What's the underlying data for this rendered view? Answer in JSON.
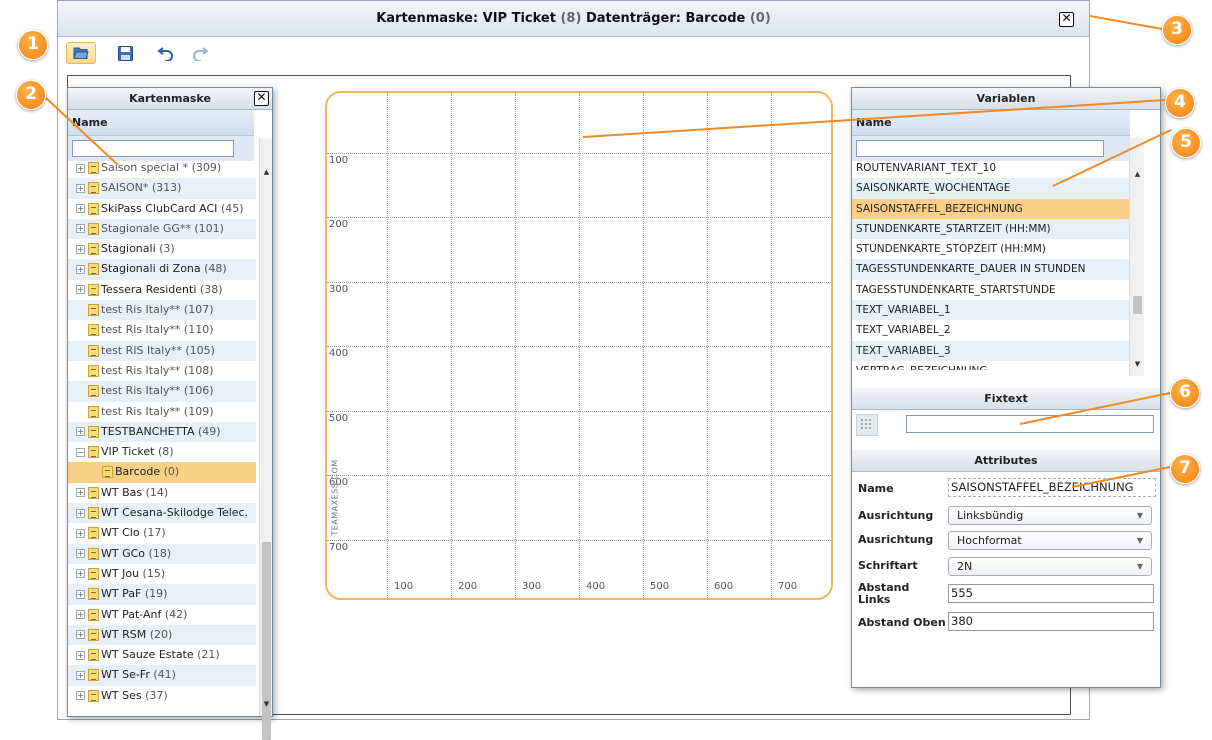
{
  "window": {
    "title_prefix": "Kartenmaske: VIP Ticket",
    "title_count1": "(8)",
    "title_mid": "Datenträger: Barcode",
    "title_count2": "(0)",
    "close_label": "✕"
  },
  "toolbar": {
    "open_icon": "folder-open-icon",
    "save_icon": "save-icon",
    "undo_icon": "undo-icon",
    "redo_icon": "redo-icon"
  },
  "kartenmaske": {
    "title": "Kartenmaske",
    "column": "Name",
    "filter_value": "",
    "rows": [
      {
        "label": "Saison special *",
        "count": "(309)",
        "expand": "+",
        "gray": true
      },
      {
        "label": "SAISON*",
        "count": "(313)",
        "expand": "+",
        "gray": true
      },
      {
        "label": "SkiPass ClubCard ACI",
        "count": "(45)",
        "expand": "+",
        "gray": false
      },
      {
        "label": "Stagionale GG**",
        "count": "(101)",
        "expand": "+",
        "gray": true
      },
      {
        "label": "Stagionali",
        "count": "(3)",
        "expand": "+",
        "gray": false
      },
      {
        "label": "Stagionali di Zona",
        "count": "(48)",
        "expand": "+",
        "gray": false
      },
      {
        "label": "Tessera Residenti",
        "count": "(38)",
        "expand": "+",
        "gray": false
      },
      {
        "label": "test Ris Italy**",
        "count": "(107)",
        "expand": "",
        "gray": true
      },
      {
        "label": "test Ris Italy**",
        "count": "(110)",
        "expand": "",
        "gray": true
      },
      {
        "label": "test RIS Italy**",
        "count": "(105)",
        "expand": "",
        "gray": true
      },
      {
        "label": "test Ris Italy**",
        "count": "(108)",
        "expand": "",
        "gray": true
      },
      {
        "label": "test Ris Italy**",
        "count": "(106)",
        "expand": "",
        "gray": true
      },
      {
        "label": "test Ris Italy**",
        "count": "(109)",
        "expand": "",
        "gray": true
      },
      {
        "label": "TESTBANCHETTA",
        "count": "(49)",
        "expand": "+",
        "gray": false
      },
      {
        "label": "VIP Ticket",
        "count": "(8)",
        "expand": "−",
        "gray": false
      },
      {
        "label": "Barcode",
        "count": "(0)",
        "expand": "",
        "gray": false,
        "child": true,
        "selected": true
      },
      {
        "label": "WT Bas",
        "count": "(14)",
        "expand": "+",
        "gray": false
      },
      {
        "label": "WT Cesana-Skilodge Telec.",
        "count": "",
        "expand": "+",
        "gray": false
      },
      {
        "label": "WT Clo",
        "count": "(17)",
        "expand": "+",
        "gray": false
      },
      {
        "label": "WT GCo",
        "count": "(18)",
        "expand": "+",
        "gray": false
      },
      {
        "label": "WT Jou",
        "count": "(15)",
        "expand": "+",
        "gray": false
      },
      {
        "label": "WT PaF",
        "count": "(19)",
        "expand": "+",
        "gray": false
      },
      {
        "label": "WT Pat-Anf",
        "count": "(42)",
        "expand": "+",
        "gray": false
      },
      {
        "label": "WT RSM",
        "count": "(20)",
        "expand": "+",
        "gray": false
      },
      {
        "label": "WT Sauze Estate",
        "count": "(21)",
        "expand": "+",
        "gray": false
      },
      {
        "label": "WT Se-Fr",
        "count": "(41)",
        "expand": "+",
        "gray": false
      },
      {
        "label": "WT Ses",
        "count": "(37)",
        "expand": "+",
        "gray": false
      }
    ]
  },
  "card": {
    "y_labels": [
      "100",
      "200",
      "300",
      "400",
      "500",
      "600",
      "700"
    ],
    "x_labels": [
      "100",
      "200",
      "300",
      "400",
      "500",
      "600",
      "700"
    ],
    "watermark": "TEAMAXESS.COM"
  },
  "variablen": {
    "title": "Variablen",
    "column": "Name",
    "filter_value": "",
    "rows": [
      {
        "label": "ROUTENVARIANT_TEXT_10"
      },
      {
        "label": "SAISONKARTE_WOCHENTAGE"
      },
      {
        "label": "SAISONSTAFFEL_BEZEICHNUNG",
        "selected": true
      },
      {
        "label": "STUNDENKARTE_STARTZEIT (HH:MM)"
      },
      {
        "label": "STUNDENKARTE_STOPZEIT (HH:MM)"
      },
      {
        "label": "TAGESSTUNDENKARTE_DAUER IN STUNDEN"
      },
      {
        "label": "TAGESSTUNDENKARTE_STARTSTUNDE"
      },
      {
        "label": "TEXT_VARIABEL_1"
      },
      {
        "label": "TEXT_VARIABEL_2"
      },
      {
        "label": "TEXT_VARIABEL_3"
      },
      {
        "label": "VERTRAG_BEZEICHNUNG"
      }
    ]
  },
  "fixtext": {
    "title": "Fixtext",
    "value": ""
  },
  "attributes": {
    "title": "Attributes",
    "name_label": "Name",
    "name_value": "SAISONSTAFFEL_BEZEICHNUNG",
    "ausrichtung1_label": "Ausrichtung",
    "ausrichtung1_value": "Linksbündig",
    "ausrichtung2_label": "Ausrichtung",
    "ausrichtung2_value": "Hochformat",
    "schriftart_label": "Schriftart",
    "schriftart_value": "2N",
    "abstand_links_label": "Abstand Links",
    "abstand_links_value": "555",
    "abstand_oben_label": "Abstand Oben",
    "abstand_oben_value": "380"
  },
  "callouts": [
    "1",
    "2",
    "3",
    "4",
    "5",
    "6",
    "7"
  ],
  "colors": {
    "accent": "#f07f14",
    "selected_row": "#f8cf87",
    "card_border": "#f2b45f"
  }
}
